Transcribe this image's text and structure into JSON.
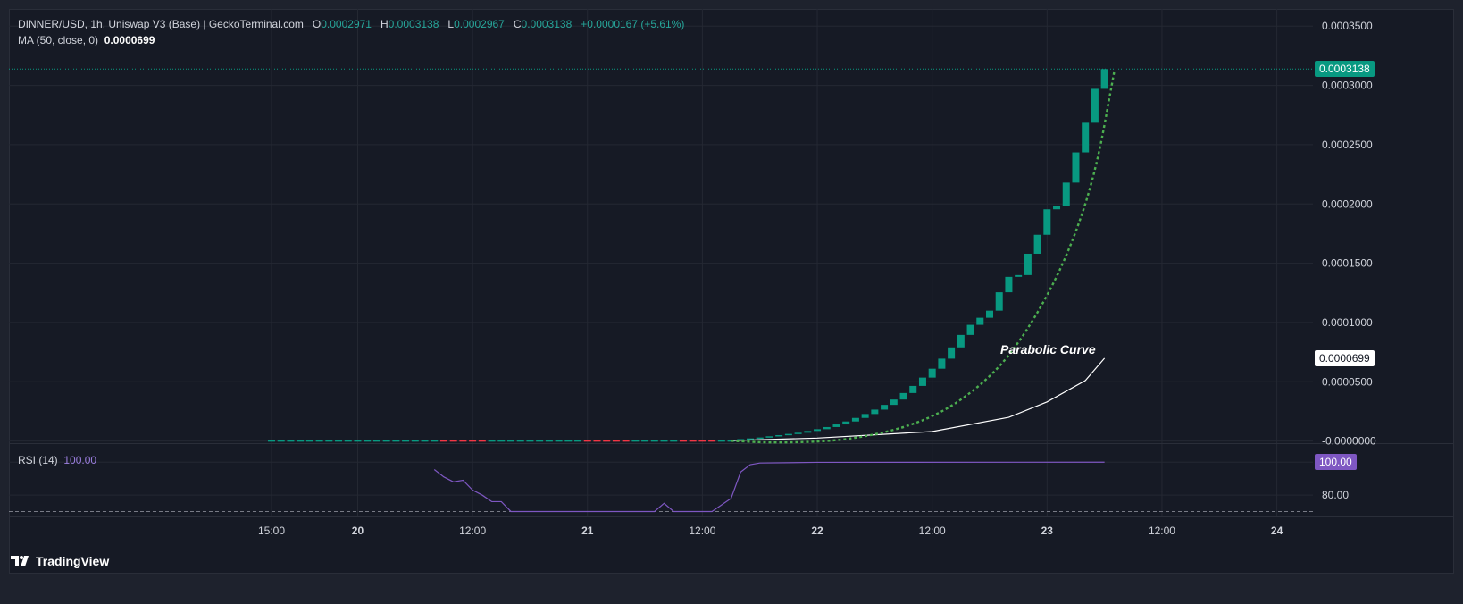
{
  "legend": {
    "pair": "DINNER/USD, 1h, Uniswap V3 (Base) | GeckoTerminal.com",
    "o_label": "O",
    "o_value": "0.0002971",
    "h_label": "H",
    "h_value": "0.0003138",
    "l_label": "L",
    "l_value": "0.0002967",
    "c_label": "C",
    "c_value": "0.0003138",
    "change": "+0.0000167 (+5.61%)",
    "ma_label": "MA (50, close, 0)",
    "ma_value": "0.0000699"
  },
  "rsi_legend": {
    "label": "RSI (14)",
    "value": "100.00"
  },
  "price_badges": {
    "last": "0.0003138",
    "ma": "0.0000699",
    "rsi": "100.00"
  },
  "annotation": "Parabolic Curve",
  "branding": "TradingView",
  "colors": {
    "up": "#089981",
    "down": "#f23645",
    "ma": "#ffffff",
    "fit": "#4caf50",
    "rsi": "#7e57c2",
    "last_badge": "#089981"
  },
  "chart_data": [
    {
      "type": "candlestick",
      "y_ticks": [
        "0.0003500",
        "0.0003000",
        "0.0002500",
        "0.0002000",
        "0.0001500",
        "0.0001000",
        "0.0000500",
        "-0.0000000"
      ],
      "x_ticks": [
        "15:00",
        "20",
        "12:00",
        "21",
        "12:00",
        "22",
        "12:00",
        "23",
        "12:00",
        "24"
      ],
      "ylim": [
        -1.8e-06,
        0.0003645
      ],
      "x_start": "2024-01-19 15:00",
      "bar_hours": 1,
      "flat_candles": {
        "from": "2024-01-19 15:00",
        "to": "2024-01-21 15:00",
        "value": 2e-07,
        "down_hours": [
          18,
          19,
          20,
          21,
          22,
          33,
          34,
          35,
          36,
          37,
          43,
          44,
          45,
          46
        ]
      },
      "rising_candles": [
        {
          "t": "2024-01-21 16:00",
          "o": 1e-06,
          "c": 1.6e-06
        },
        {
          "t": "2024-01-21 17:00",
          "o": 1.6e-06,
          "c": 2.2e-06
        },
        {
          "t": "2024-01-21 18:00",
          "o": 2.2e-06,
          "c": 3e-06
        },
        {
          "t": "2024-01-21 19:00",
          "o": 3e-06,
          "c": 4e-06
        },
        {
          "t": "2024-01-21 20:00",
          "o": 4e-06,
          "c": 5e-06
        },
        {
          "t": "2024-01-21 21:00",
          "o": 5e-06,
          "c": 6e-06
        },
        {
          "t": "2024-01-21 22:00",
          "o": 6e-06,
          "c": 7e-06
        },
        {
          "t": "2024-01-21 23:00",
          "o": 7e-06,
          "c": 8.5e-06
        },
        {
          "t": "2024-01-22 00:00",
          "o": 8.5e-06,
          "c": 1e-05
        },
        {
          "t": "2024-01-22 01:00",
          "o": 1e-05,
          "c": 1.18e-05
        },
        {
          "t": "2024-01-22 02:00",
          "o": 1.18e-05,
          "c": 1.4e-05
        },
        {
          "t": "2024-01-22 03:00",
          "o": 1.4e-05,
          "c": 1.65e-05
        },
        {
          "t": "2024-01-22 04:00",
          "o": 1.65e-05,
          "c": 1.95e-05
        },
        {
          "t": "2024-01-22 05:00",
          "o": 1.95e-05,
          "c": 2.28e-05
        },
        {
          "t": "2024-01-22 06:00",
          "o": 2.28e-05,
          "c": 2.65e-05
        },
        {
          "t": "2024-01-22 07:00",
          "o": 2.65e-05,
          "c": 3.05e-05
        },
        {
          "t": "2024-01-22 08:00",
          "o": 3.05e-05,
          "c": 3.5e-05
        },
        {
          "t": "2024-01-22 09:00",
          "o": 3.5e-05,
          "c": 4.05e-05
        },
        {
          "t": "2024-01-22 10:00",
          "o": 4.05e-05,
          "c": 4.65e-05
        },
        {
          "t": "2024-01-22 11:00",
          "o": 4.65e-05,
          "c": 5.35e-05
        },
        {
          "t": "2024-01-22 12:00",
          "o": 5.35e-05,
          "c": 6.1e-05
        },
        {
          "t": "2024-01-22 13:00",
          "o": 6.1e-05,
          "c": 6.95e-05
        },
        {
          "t": "2024-01-22 14:00",
          "o": 6.95e-05,
          "c": 7.9e-05
        },
        {
          "t": "2024-01-22 15:00",
          "o": 7.9e-05,
          "c": 8.95e-05
        },
        {
          "t": "2024-01-22 16:00",
          "o": 8.95e-05,
          "c": 9.8e-05
        },
        {
          "t": "2024-01-22 17:00",
          "o": 9.8e-05,
          "c": 0.000104
        },
        {
          "t": "2024-01-22 18:00",
          "o": 0.000104,
          "c": 0.00011
        },
        {
          "t": "2024-01-22 19:00",
          "o": 0.00011,
          "c": 0.0001255
        },
        {
          "t": "2024-01-22 20:00",
          "o": 0.0001255,
          "c": 0.0001385
        },
        {
          "t": "2024-01-22 21:00",
          "o": 0.0001385,
          "c": 0.00014
        },
        {
          "t": "2024-01-22 22:00",
          "o": 0.00014,
          "c": 0.000158
        },
        {
          "t": "2024-01-22 23:00",
          "o": 0.000158,
          "c": 0.000174
        },
        {
          "t": "2024-01-23 00:00",
          "o": 0.000174,
          "c": 0.0001955
        },
        {
          "t": "2024-01-23 01:00",
          "o": 0.0001955,
          "c": 0.0001985
        },
        {
          "t": "2024-01-23 02:00",
          "o": 0.0001985,
          "c": 0.000218
        },
        {
          "t": "2024-01-23 03:00",
          "o": 0.000218,
          "c": 0.0002435
        },
        {
          "t": "2024-01-23 04:00",
          "o": 0.0002435,
          "c": 0.0002685
        },
        {
          "t": "2024-01-23 05:00",
          "o": 0.0002685,
          "c": 0.0002971
        },
        {
          "t": "2024-01-23 06:00",
          "o": 0.0002971,
          "c": 0.0003138
        }
      ],
      "ma_line": [
        {
          "t": "2024-01-21 15:00",
          "y": 4e-07
        },
        {
          "t": "2024-01-22 00:00",
          "y": 2.5e-06
        },
        {
          "t": "2024-01-22 12:00",
          "y": 8e-06
        },
        {
          "t": "2024-01-22 20:00",
          "y": 2e-05
        },
        {
          "t": "2024-01-23 00:00",
          "y": 3.3e-05
        },
        {
          "t": "2024-01-23 04:00",
          "y": 5.1e-05
        },
        {
          "t": "2024-01-23 06:00",
          "y": 6.99e-05
        }
      ],
      "parabolic_curve": [
        {
          "t": "2024-01-21 15:00",
          "y": 2e-07
        },
        {
          "t": "2024-01-21 20:00",
          "y": -1.8e-06
        },
        {
          "t": "2024-01-22 04:00",
          "y": 1e-06
        },
        {
          "t": "2024-01-22 12:00",
          "y": 1.8e-05
        },
        {
          "t": "2024-01-22 18:00",
          "y": 5.2e-05
        },
        {
          "t": "2024-01-22 22:00",
          "y": 9.3e-05
        },
        {
          "t": "2024-01-23 02:00",
          "y": 0.000153
        },
        {
          "t": "2024-01-23 05:00",
          "y": 0.000223
        },
        {
          "t": "2024-01-23 07:00",
          "y": 0.000311
        }
      ],
      "last_price": 0.0003138
    },
    {
      "type": "line",
      "y_ticks": [
        "80.00"
      ],
      "rsi_line": [
        {
          "t": "2024-01-20 08:00",
          "y": 95.5
        },
        {
          "t": "2024-01-20 09:00",
          "y": 91
        },
        {
          "t": "2024-01-20 10:00",
          "y": 88
        },
        {
          "t": "2024-01-20 11:00",
          "y": 89
        },
        {
          "t": "2024-01-20 12:00",
          "y": 83
        },
        {
          "t": "2024-01-20 13:00",
          "y": 80
        },
        {
          "t": "2024-01-20 14:00",
          "y": 76
        },
        {
          "t": "2024-01-20 15:00",
          "y": 76
        },
        {
          "t": "2024-01-20 16:00",
          "y": 70
        },
        {
          "t": "2024-01-21 07:00",
          "y": 70
        },
        {
          "t": "2024-01-21 08:00",
          "y": 75
        },
        {
          "t": "2024-01-21 09:00",
          "y": 70
        },
        {
          "t": "2024-01-21 13:00",
          "y": 70
        },
        {
          "t": "2024-01-21 14:00",
          "y": 74
        },
        {
          "t": "2024-01-21 15:00",
          "y": 78
        },
        {
          "t": "2024-01-21 16:00",
          "y": 94
        },
        {
          "t": "2024-01-21 17:00",
          "y": 98.5
        },
        {
          "t": "2024-01-21 18:00",
          "y": 99.5
        },
        {
          "t": "2024-01-22 00:00",
          "y": 99.9
        },
        {
          "t": "2024-01-23 06:00",
          "y": 100
        }
      ],
      "ylim": [
        67,
        111
      ],
      "reference_line": 70,
      "last_value": 100
    }
  ]
}
